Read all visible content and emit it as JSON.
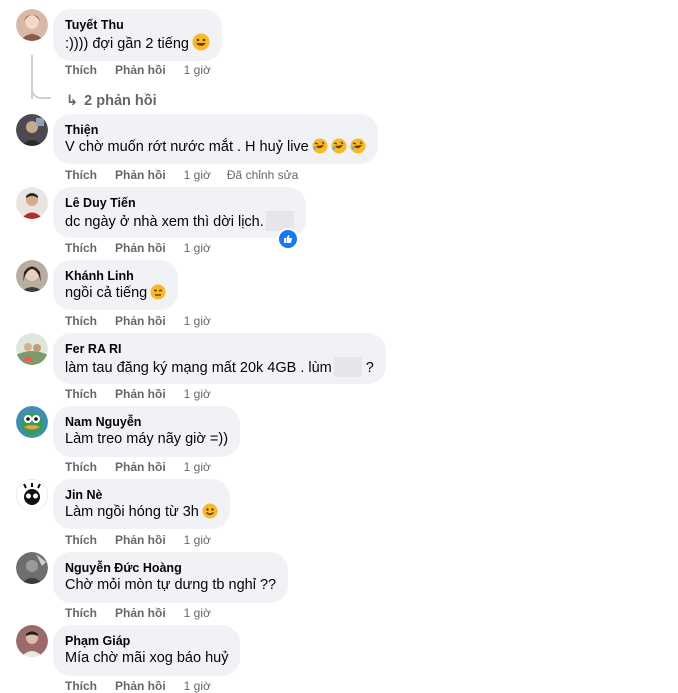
{
  "actions": {
    "like": "Thích",
    "reply": "Phản hồi"
  },
  "comments": [
    {
      "author": "Tuyết Thu",
      "text": ":)))) đợi gần 2 tiếng",
      "emoji": [
        "grin-face"
      ],
      "time": "1 giờ",
      "edited": ""
    },
    {
      "author": "Thiện",
      "text": "V chờ muốn rớt nước mắt . H huỷ live",
      "emoji": [
        "rofl-face",
        "rofl-face",
        "rofl-face"
      ],
      "time": "1 giờ",
      "edited": "Đã chỉnh sửa"
    },
    {
      "author": "Lê Duy Tiến",
      "text": "dc ngày ở nhà xem thì dời lịch.",
      "text_after": "",
      "emoji": [],
      "time": "1 giờ",
      "edited": "",
      "reaction": "like-icon"
    },
    {
      "author": "Khánh Linh",
      "text": "ngồi cả tiếng",
      "emoji": [
        "unamused-face"
      ],
      "time": "1 giờ",
      "edited": ""
    },
    {
      "author": "Fer RA RI",
      "text": "làm tau đăng ký mạng mất 20k 4GB . lùm",
      "text_after": " ?",
      "emoji": [],
      "time": "1 giờ",
      "edited": ""
    },
    {
      "author": "Nam Nguyễn",
      "text": "Làm treo máy nãy giờ =))",
      "emoji": [],
      "time": "1 giờ",
      "edited": ""
    },
    {
      "author": "Jin Nè",
      "text": "Làm ngồi hóng từ 3h",
      "emoji": [
        "smile-face"
      ],
      "time": "1 giờ",
      "edited": ""
    },
    {
      "author": "Nguyễn Đức Hoàng",
      "text": "Chờ mỏi mòn tự dưng tb nghỉ ??",
      "emoji": [],
      "time": "1 giờ",
      "edited": ""
    },
    {
      "author": "Phạm Giáp",
      "text": "Mía chờ mãi xog báo huỷ",
      "emoji": [],
      "time": "1 giờ",
      "edited": ""
    }
  ],
  "replies_link": "2 phản hồi",
  "colors": {
    "bubble": "#f0f2f5",
    "muted": "#65676b",
    "like_blue": "#1877f2"
  }
}
